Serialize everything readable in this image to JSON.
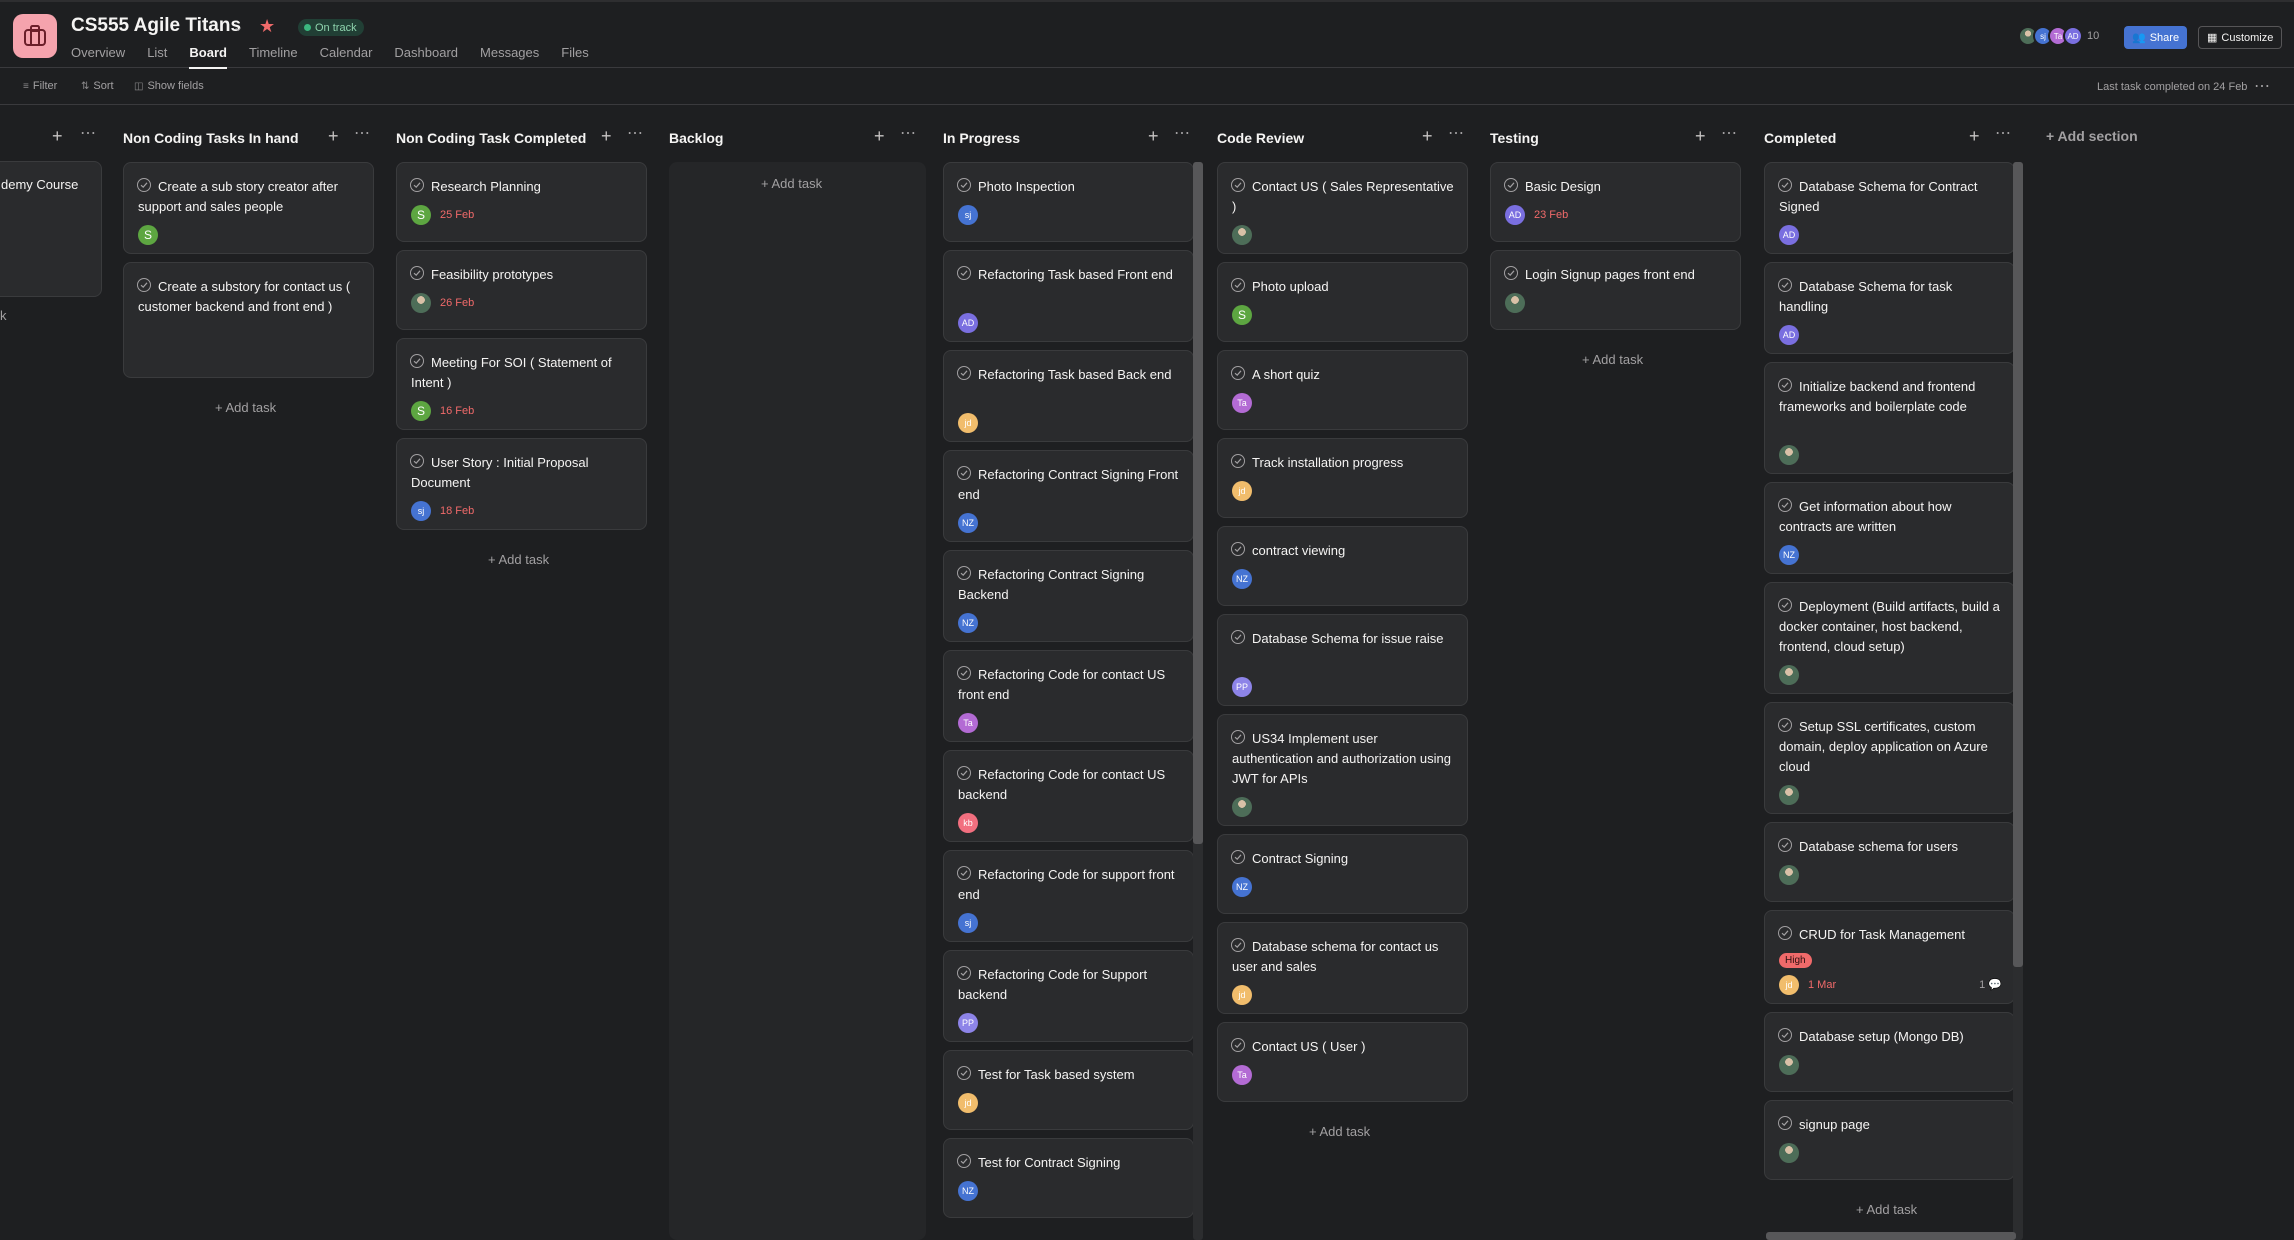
{
  "project": {
    "title": "CS555 Agile Titans",
    "status": "On track",
    "icon": "briefcase-icon",
    "accent": "#f5a3ad",
    "tabs": [
      "Overview",
      "List",
      "Board",
      "Timeline",
      "Calendar",
      "Dashboard",
      "Messages",
      "Files"
    ],
    "active_tab": "Board"
  },
  "header_right": {
    "avatars": [
      "sj",
      "Ta",
      "AD"
    ],
    "member_count": "10",
    "share_label": "Share",
    "customize_label": "Customize"
  },
  "toolbar": {
    "filter": "Filter",
    "sort": "Sort",
    "show_fields": "Show fields",
    "last_task": "Last task completed on 24 Feb"
  },
  "partial_column": {
    "card_text": "demy Course",
    "add_task_fragment": "k"
  },
  "add_task_label": "+ Add task",
  "add_section_label": "+ Add section",
  "columns": [
    {
      "title": "Non Coding Tasks In hand",
      "cards": [
        {
          "title": "Create a sub story creator after support and sales people",
          "assignee": "S"
        },
        {
          "title": "Create a substory for contact us ( customer backend and front end )"
        }
      ]
    },
    {
      "title": "Non Coding Task  Completed",
      "cards": [
        {
          "title": "Research Planning",
          "assignee": "S",
          "due": "25 Feb"
        },
        {
          "title": "Feasibility prototypes",
          "assignee": "photo",
          "due": "26 Feb"
        },
        {
          "title": "Meeting For SOI ( Statement of Intent )",
          "assignee": "S",
          "due": "16 Feb"
        },
        {
          "title": "User Story : Initial Proposal Document",
          "assignee": "sj",
          "due": "18 Feb"
        }
      ]
    },
    {
      "title": "Backlog",
      "cards": []
    },
    {
      "title": "In Progress",
      "cards": [
        {
          "title": "Photo Inspection",
          "assignee": "sj"
        },
        {
          "title": "Refactoring Task based Front end",
          "assignee": "AD"
        },
        {
          "title": "Refactoring Task based Back end",
          "assignee": "jd"
        },
        {
          "title": "Refactoring Contract Signing Front end",
          "assignee": "NZ"
        },
        {
          "title": "Refactoring Contract Signing Backend",
          "assignee": "NZ"
        },
        {
          "title": "Refactoring Code for contact US front end",
          "assignee": "Ta"
        },
        {
          "title": "Refactoring Code for contact US backend",
          "assignee": "kb"
        },
        {
          "title": "Refactoring Code for support front end",
          "assignee": "sj"
        },
        {
          "title": "Refactoring Code for Support backend",
          "assignee": "PP"
        },
        {
          "title": "Test for Task based system",
          "assignee": "jd"
        },
        {
          "title": "Test for Contract Signing",
          "assignee": "NZ"
        }
      ]
    },
    {
      "title": "Code Review",
      "cards": [
        {
          "title": "Contact US ( Sales Representative )",
          "assignee": "photo"
        },
        {
          "title": "Photo upload",
          "assignee": "S"
        },
        {
          "title": "A short quiz",
          "assignee": "Ta"
        },
        {
          "title": "Track installation progress",
          "assignee": "jd"
        },
        {
          "title": "contract viewing",
          "assignee": "NZ"
        },
        {
          "title": "Database Schema for issue raise",
          "assignee": "PP"
        },
        {
          "title": "US34 Implement user authentication and authorization using JWT for APIs",
          "assignee": "photo"
        },
        {
          "title": "Contract Signing",
          "assignee": "NZ"
        },
        {
          "title": "Database schema for contact us user and sales",
          "assignee": "jd"
        },
        {
          "title": "Contact US ( User )",
          "assignee": "Ta"
        }
      ]
    },
    {
      "title": "Testing",
      "cards": [
        {
          "title": "Basic Design",
          "assignee": "AD",
          "due": "23 Feb"
        },
        {
          "title": "Login Signup pages front end",
          "assignee": "photo"
        }
      ]
    },
    {
      "title": "Completed",
      "cards": [
        {
          "title": "Database Schema for Contract Signed",
          "assignee": "AD"
        },
        {
          "title": "Database Schema for task handling",
          "assignee": "AD"
        },
        {
          "title": "Initialize backend and frontend frameworks and boilerplate code",
          "assignee": "photo"
        },
        {
          "title": "Get information about how contracts are written",
          "assignee": "NZ"
        },
        {
          "title": "Deployment (Build artifacts, build a docker container, host backend, frontend, cloud setup)",
          "assignee": "photo"
        },
        {
          "title": "Setup SSL certificates, custom domain, deploy application on Azure cloud",
          "assignee": "photo"
        },
        {
          "title": "Database schema for users",
          "assignee": "photo"
        },
        {
          "title": "CRUD for Task Management",
          "assignee": "jd",
          "due": "1 Mar",
          "priority": "High",
          "comments": "1"
        },
        {
          "title": "Database setup (Mongo DB)",
          "assignee": "photo"
        },
        {
          "title": "signup page",
          "assignee": "photo"
        }
      ]
    }
  ],
  "avatar_colors": {
    "S": "#5da641",
    "sj": "#4573d2",
    "AD": "#7a6fe0",
    "jd": "#f1bd6c",
    "NZ": "#4573d2",
    "Ta": "#b36bd4",
    "kb": "#f26f7f",
    "PP": "#8d84e8"
  }
}
